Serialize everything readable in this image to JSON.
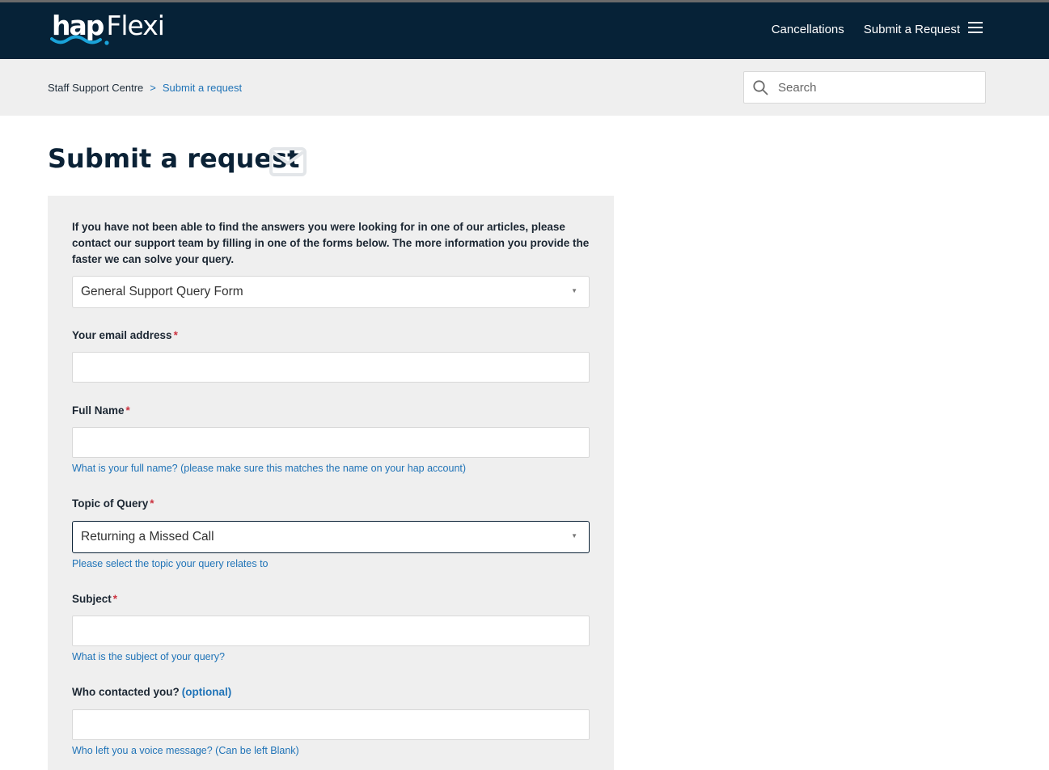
{
  "header": {
    "logo_hap": "hap",
    "logo_flexi": "Flexi",
    "nav": {
      "cancellations": "Cancellations",
      "submit_request": "Submit a Request"
    }
  },
  "breadcrumb": {
    "home": "Staff Support Centre",
    "separator": ">",
    "current": "Submit a request"
  },
  "search": {
    "placeholder": "Search"
  },
  "page": {
    "title": "Submit a request"
  },
  "form": {
    "intro": "If you have not been able to find the answers you were looking for in one of our articles, please contact our support team by filling in one of the forms below. The more information you provide the faster we can solve your query.",
    "form_select": "General Support Query Form",
    "email_label": "Your email address",
    "required_mark": "*",
    "full_name_label": "Full Name",
    "full_name_hint": "What is your full name? (please make sure this matches the name on your hap account)",
    "topic_label": "Topic of Query",
    "topic_select": "Returning a Missed Call",
    "topic_hint": "Please select the topic your query relates to",
    "subject_label": "Subject",
    "subject_hint": "What is the subject of your query?",
    "contact_label": "Who contacted you?",
    "optional_mark": "(optional)",
    "contact_hint": "Who left you a voice message? (Can be left Blank)"
  },
  "colors": {
    "header_bg": "#062237",
    "link_blue": "#1f73b7",
    "required_red": "#cc3340",
    "panel_bg": "#efefef",
    "logo_wave": "#1aa3d9"
  }
}
